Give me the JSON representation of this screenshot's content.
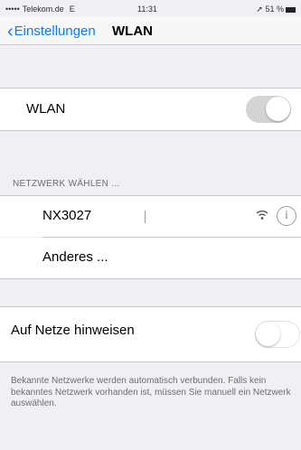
{
  "statusbar": {
    "signal": "•••••",
    "carrier": "Telekom.de",
    "network": "E",
    "time": "11:31",
    "location": "➚",
    "battery": "51 %"
  },
  "navbar": {
    "back_label": "Einstellungen",
    "title": "WLAN"
  },
  "wlan_row": {
    "label": "WLAN",
    "toggle_on": true
  },
  "section_header": "NETZWERK WÄHLEN ...",
  "networks": [
    {
      "name": "NX3027",
      "signal_icon": "wifi-icon",
      "info_icon": "info-icon"
    }
  ],
  "other_network": "Anderes ...",
  "ask_row": {
    "label": "Auf Netze hinweisen",
    "toggle_on": false
  },
  "footer_text": "Bekannte Netzwerke werden automatisch verbunden. Falls kein bekanntes Netzwerk vorhanden ist, müssen Sie manuell ein Netzwerk auswählen.",
  "colors": {
    "accent": "#0a7bff",
    "background": "#efeff4",
    "separator": "#c8c7cc"
  }
}
